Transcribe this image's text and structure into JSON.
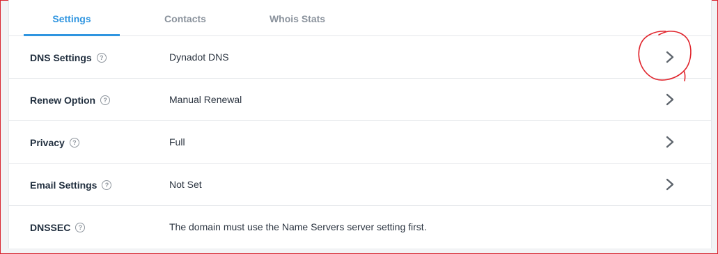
{
  "tabs": [
    {
      "label": "Settings",
      "active": true
    },
    {
      "label": "Contacts",
      "active": false
    },
    {
      "label": "Whois Stats",
      "active": false
    }
  ],
  "rows": [
    {
      "label": "DNS Settings",
      "value": "Dynadot DNS",
      "has_chevron": true
    },
    {
      "label": "Renew Option",
      "value": "Manual Renewal",
      "has_chevron": true
    },
    {
      "label": "Privacy",
      "value": "Full",
      "has_chevron": true
    },
    {
      "label": "Email Settings",
      "value": "Not Set",
      "has_chevron": true
    },
    {
      "label": "DNSSEC",
      "value": "The domain must use the Name Servers server setting first.",
      "has_chevron": false
    }
  ],
  "help_icon_glyph": "?",
  "icons": {
    "help": "question-circle-icon",
    "chevron": "chevron-right-icon"
  },
  "colors": {
    "accent": "#2f95e0",
    "annotation": "#e0242c",
    "label_text": "#1f2d3d",
    "muted_tab": "#8a929c"
  }
}
